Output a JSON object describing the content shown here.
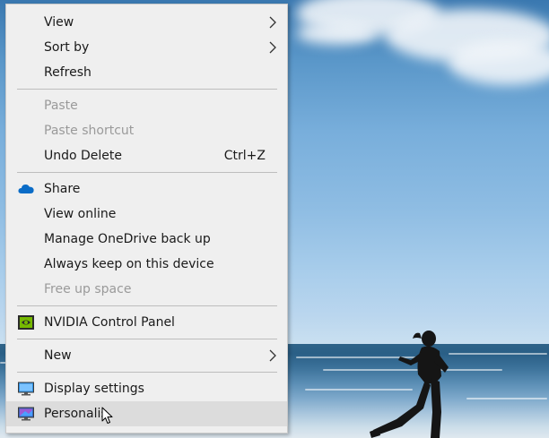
{
  "context_menu": {
    "view": {
      "label": "View"
    },
    "sort_by": {
      "label": "Sort by"
    },
    "refresh": {
      "label": "Refresh"
    },
    "paste": {
      "label": "Paste"
    },
    "paste_shortcut": {
      "label": "Paste shortcut"
    },
    "undo_delete": {
      "label": "Undo Delete",
      "shortcut": "Ctrl+Z"
    },
    "share": {
      "label": "Share",
      "icon": "onedrive-cloud-icon"
    },
    "view_online": {
      "label": "View online"
    },
    "manage_onedrive": {
      "label": "Manage OneDrive back up"
    },
    "always_keep": {
      "label": "Always keep on this device"
    },
    "free_up_space": {
      "label": "Free up space"
    },
    "nvidia": {
      "label": "NVIDIA Control Panel",
      "icon": "nvidia-icon"
    },
    "new": {
      "label": "New"
    },
    "display_settings": {
      "label": "Display settings",
      "icon": "display-settings-icon"
    },
    "personalize": {
      "label": "Personalis",
      "icon": "personalize-icon"
    }
  },
  "colors": {
    "menu_background": "#efefef",
    "hover": "#dcdcdc",
    "disabled_text": "#9a9a9a",
    "onedrive_blue": "#0a6cc7",
    "nvidia_green": "#76b900"
  }
}
